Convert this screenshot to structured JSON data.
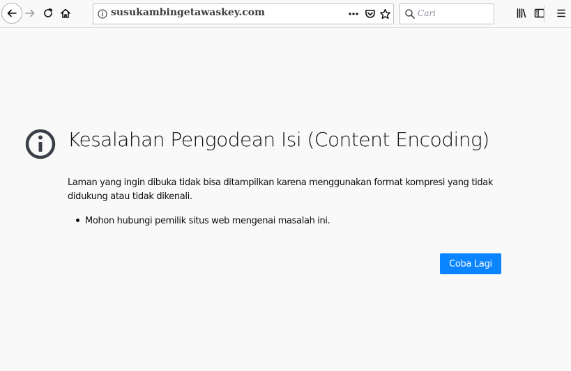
{
  "toolbar": {
    "url": "susukambingetawaskey.com",
    "search_placeholder": "Cari"
  },
  "icons": {
    "back": "back-arrow-icon",
    "forward": "forward-arrow-icon",
    "reload": "reload-icon",
    "home": "home-icon",
    "site_info": "info-icon",
    "more": "more-icon",
    "pocket": "pocket-icon",
    "bookmark": "star-icon",
    "search": "search-icon",
    "library": "library-icon",
    "sidebar": "sidebar-icon",
    "menu": "hamburger-menu-icon"
  },
  "error": {
    "title": "Kesalahan Pengodean Isi (Content Encoding)",
    "description": "Laman yang ingin dibuka tidak bisa ditampilkan karena menggunakan format kompresi yang tidak didukung atau tidak dikenali.",
    "bullets": [
      "Mohon hubungi pemilik situs web mengenai masalah ini."
    ],
    "retry_label": "Coba Lagi"
  },
  "colors": {
    "accent": "#0a84ff",
    "background": "#f9f9fa",
    "text": "#0c0c0d",
    "icon": "#4a4a4f"
  }
}
